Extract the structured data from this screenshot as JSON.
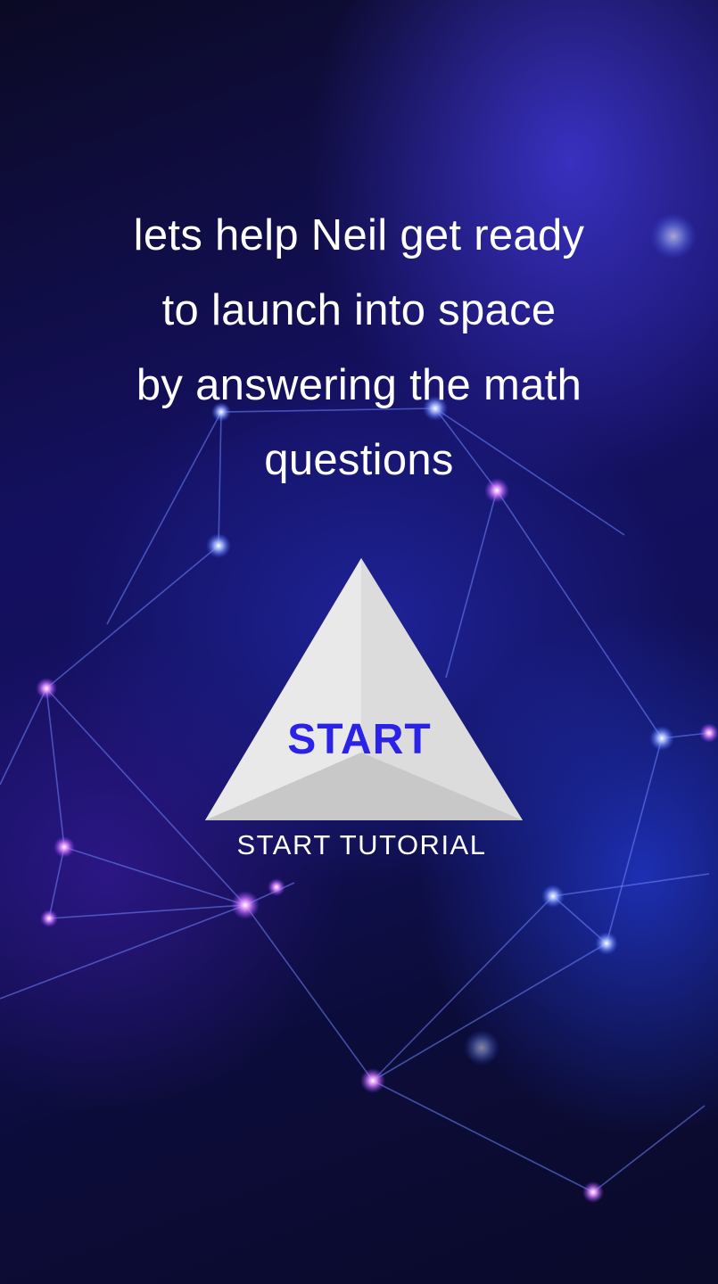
{
  "intro": {
    "text": "lets help Neil get ready\nto launch into space\nby answering the math\nquestions"
  },
  "start_button": {
    "label": "START"
  },
  "tutorial": {
    "label": "START TUTORIAL"
  },
  "colors": {
    "background": "#141060",
    "start_label": "#2a22e6",
    "triangle": "#e6e6e6",
    "node_glow": "#d66cff"
  }
}
